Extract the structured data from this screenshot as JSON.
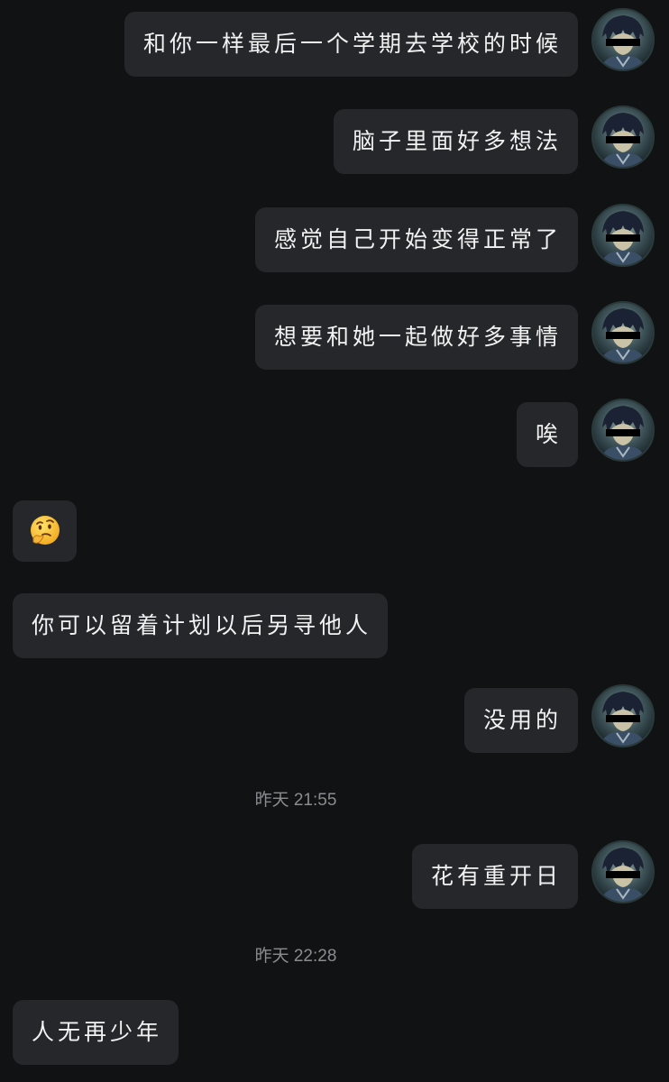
{
  "conversation": {
    "messages": [
      {
        "side": "right",
        "text": "和你一样最后一个学期去学校的时候",
        "avatar": "anime-avatar-censored"
      },
      {
        "side": "right",
        "text": "脑子里面好多想法",
        "avatar": "anime-avatar-censored"
      },
      {
        "side": "right",
        "text": "感觉自己开始变得正常了",
        "avatar": "anime-avatar-censored"
      },
      {
        "side": "right",
        "text": "想要和她一起做好多事情",
        "avatar": "anime-avatar-censored"
      },
      {
        "side": "right",
        "text": "唉",
        "avatar": "anime-avatar-censored"
      },
      {
        "side": "left",
        "emoji": "thinking-face-emoji"
      },
      {
        "side": "left",
        "text": "你可以留着计划以后另寻他人"
      },
      {
        "side": "right",
        "text": "没用的",
        "avatar": "anime-avatar-censored"
      },
      {
        "side": "right",
        "text": "花有重开日",
        "avatar": "anime-avatar-censored"
      },
      {
        "side": "left",
        "text": "人无再少年"
      }
    ],
    "timestamps": [
      "昨天 21:55",
      "昨天 22:28"
    ]
  },
  "colors": {
    "background": "#111214",
    "bubble": "#25272b",
    "text": "#f2f2f2",
    "timestamp": "#8a8c90"
  }
}
